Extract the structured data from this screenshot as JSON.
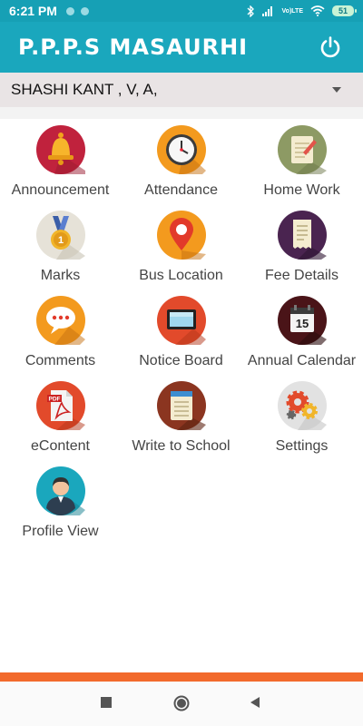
{
  "status_bar": {
    "time": "6:21 PM",
    "volte_top": "Vo)",
    "volte_bottom": "LTE",
    "battery": "51"
  },
  "app_bar": {
    "title": "P.P.P.S MASAURHI",
    "power_icon": "power-icon"
  },
  "user_select": {
    "value": "SHASHI KANT , V, A,"
  },
  "tiles": [
    {
      "label": "Announcement",
      "icon": "bell-icon"
    },
    {
      "label": "Attendance",
      "icon": "clock-icon"
    },
    {
      "label": "Home Work",
      "icon": "notepad-icon"
    },
    {
      "label": "Marks",
      "icon": "medal-icon"
    },
    {
      "label": "Bus Location",
      "icon": "location-pin-icon"
    },
    {
      "label": "Fee Details",
      "icon": "receipt-icon"
    },
    {
      "label": "Comments",
      "icon": "speech-bubble-icon"
    },
    {
      "label": "Notice Board",
      "icon": "board-icon"
    },
    {
      "label": "Annual Calendar",
      "icon": "calendar-icon"
    },
    {
      "label": "eContent",
      "icon": "pdf-icon"
    },
    {
      "label": "Write to School",
      "icon": "notebook-icon"
    },
    {
      "label": "Settings",
      "icon": "gears-icon"
    },
    {
      "label": "Profile View",
      "icon": "user-avatar-icon"
    }
  ],
  "calendar_day": "15",
  "pdf_text": "PDF",
  "marks_digit": "1",
  "colors": {
    "status_bar": "#16a0b5",
    "app_bar": "#1aa7bd",
    "accent_strip": "#f26a2c"
  }
}
